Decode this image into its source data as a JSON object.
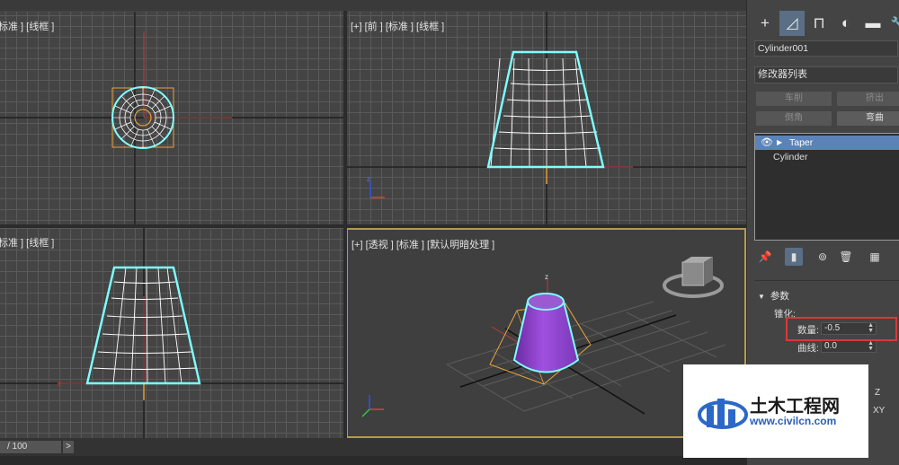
{
  "viewports": {
    "top_left": {
      "label": "标准 ] [线框 ]"
    },
    "top_right": {
      "label": "[+] [前 ] [标准 ] [线框 ]"
    },
    "bottom_left": {
      "label": "标准 ] [线框 ]"
    },
    "bottom_right": {
      "label": "[+] [透视 ] [标准 ] [默认明暗处理 ]"
    }
  },
  "timeline": {
    "frame": "/ 100",
    "next_label": ">"
  },
  "command_panel": {
    "tabs": [
      {
        "name": "create-tab-icon",
        "glyph": "+"
      },
      {
        "name": "modify-tab-icon",
        "glyph": "◿"
      },
      {
        "name": "hierarchy-tab-icon",
        "glyph": "⊓"
      },
      {
        "name": "motion-tab-icon",
        "glyph": "◐"
      },
      {
        "name": "display-tab-icon",
        "glyph": "▬"
      },
      {
        "name": "utilities-tab-icon",
        "glyph": "🔧"
      }
    ],
    "object_name": "Cylinder001",
    "modifier_list": "修改器列表",
    "buttons": {
      "lathe": "车削",
      "extrude": "挤出",
      "chamfer": "倒角",
      "bend": "弯曲"
    },
    "stack": {
      "items": [
        "Taper",
        "Cylinder"
      ]
    },
    "stack_tools": [
      "pin-stack-icon",
      "show-end-result-icon",
      "make-unique-icon",
      "remove-modifier-icon",
      "configure-sets-icon"
    ],
    "params": {
      "rollout_title": "参数",
      "section": "锥化:",
      "amount_label": "数量:",
      "amount_value": "-0.5",
      "curve_label": "曲线:",
      "curve_value": "0.0",
      "axis_z": "Z",
      "axis_xy": "XY"
    },
    "highlight_color": "#d9383a",
    "active_color": "#5a6f86"
  },
  "watermark": {
    "title": "土木工程网",
    "url": "www.civilcn.com"
  }
}
